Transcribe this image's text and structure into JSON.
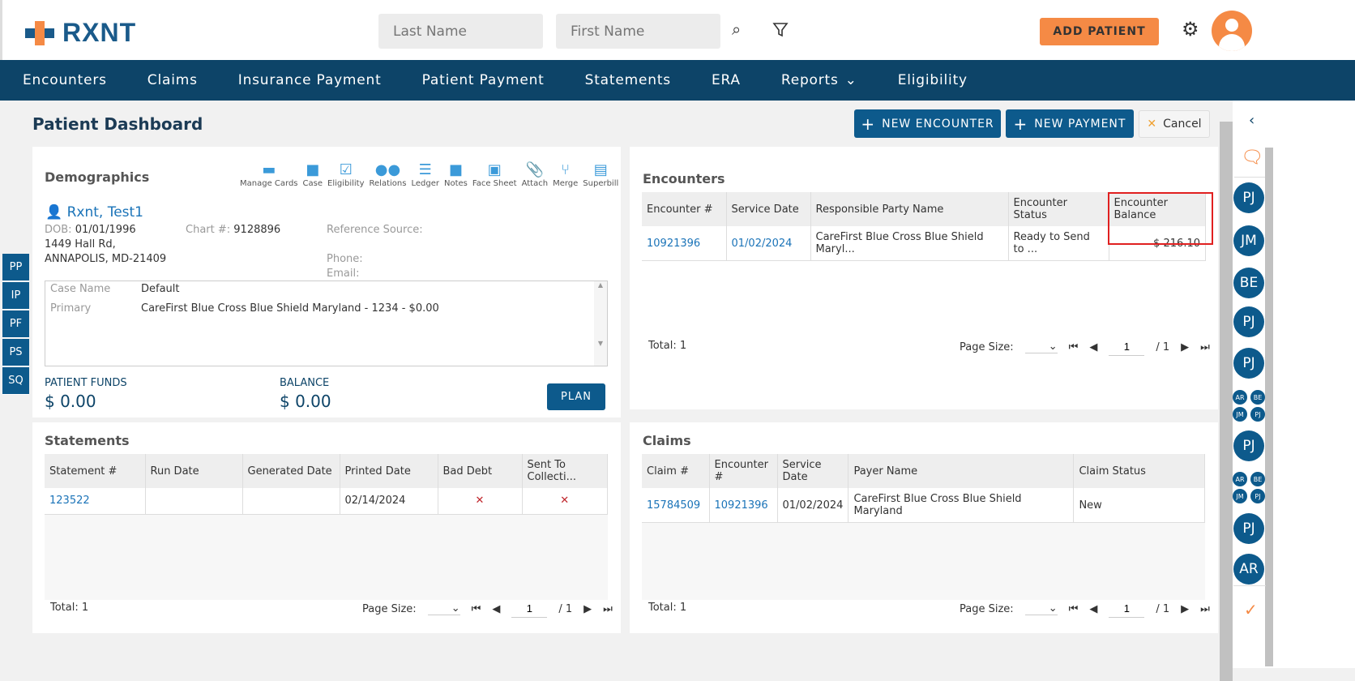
{
  "app": {
    "logo": "RXNT"
  },
  "header": {
    "last_name_placeholder": "Last Name",
    "first_name_placeholder": "First Name",
    "add_patient": "ADD PATIENT"
  },
  "nav": [
    "Encounters",
    "Claims",
    "Insurance Payment",
    "Patient Payment",
    "Statements",
    "ERA",
    "Reports",
    "Eligibility"
  ],
  "page": {
    "title": "Patient Dashboard",
    "new_encounter": "NEW ENCOUNTER",
    "new_payment": "NEW PAYMENT",
    "cancel": "Cancel"
  },
  "side_tabs": [
    "PP",
    "IP",
    "PF",
    "PS",
    "SQ"
  ],
  "demographics": {
    "title": "Demographics",
    "actions": [
      "Manage Cards",
      "Case",
      "Eligibility",
      "Relations",
      "Ledger",
      "Notes",
      "Face Sheet",
      "Attach",
      "Merge",
      "Superbill"
    ],
    "name": "Rxnt, Test1",
    "dob_label": "DOB:",
    "dob": "01/01/1996",
    "chart_label": "Chart #:",
    "chart": "9128896",
    "address1": "1449 Hall Rd,",
    "address2": "ANNAPOLIS, MD-21409",
    "ref_label": "Reference Source:",
    "phone_label": "Phone:",
    "email_label": "Email:",
    "case_name_label": "Case Name",
    "case_name": "Default",
    "primary_label": "Primary",
    "primary": "CareFirst Blue Cross Blue Shield Maryland - 1234 - $0.00",
    "funds_label": "PATIENT FUNDS",
    "funds": "$ 0.00",
    "balance_label": "BALANCE",
    "balance": "$ 0.00",
    "plan": "PLAN"
  },
  "encounters": {
    "title": "Encounters",
    "headers": [
      "Encounter #",
      "Service Date",
      "Responsible Party Name",
      "Encounter Status",
      "Encounter Balance"
    ],
    "rows": [
      [
        "10921396",
        "01/02/2024",
        "CareFirst Blue Cross Blue Shield Maryl...",
        "Ready to Send to ...",
        "$ 216.10"
      ]
    ],
    "total": "Total: 1",
    "page_size": "Page Size:",
    "page": "1",
    "pages": "/ 1"
  },
  "statements": {
    "title": "Statements",
    "headers": [
      "Statement #",
      "Run Date",
      "Generated Date",
      "Printed Date",
      "Bad Debt",
      "Sent To Collecti..."
    ],
    "rows": [
      [
        "123522",
        "",
        "",
        "02/14/2024",
        "✕",
        "✕"
      ]
    ],
    "total": "Total: 1",
    "page_size": "Page Size:",
    "page": "1",
    "pages": "/ 1"
  },
  "claims": {
    "title": "Claims",
    "headers": [
      "Claim #",
      "Encounter #",
      "Service Date",
      "Payer Name",
      "Claim Status"
    ],
    "rows": [
      [
        "15784509",
        "10921396",
        "01/02/2024",
        "CareFirst Blue Cross Blue Shield Maryland",
        "New"
      ]
    ],
    "total": "Total: 1",
    "page_size": "Page Size:",
    "page": "1",
    "pages": "/ 1"
  },
  "right_panel": {
    "avatars": [
      "PJ",
      "JM",
      "BE",
      "PJ",
      "PJ"
    ],
    "group1": [
      "AR",
      "BE",
      "JM",
      "PJ"
    ],
    "avatar6": "PJ",
    "group2": [
      "AR",
      "BE",
      "JM",
      "PJ"
    ],
    "avatar7": "PJ",
    "avatar8": "AR"
  },
  "colors": {
    "nav": "#0d4468",
    "primary": "#0d5a8c",
    "accent": "#f58a45",
    "highlight": "#e02020"
  }
}
